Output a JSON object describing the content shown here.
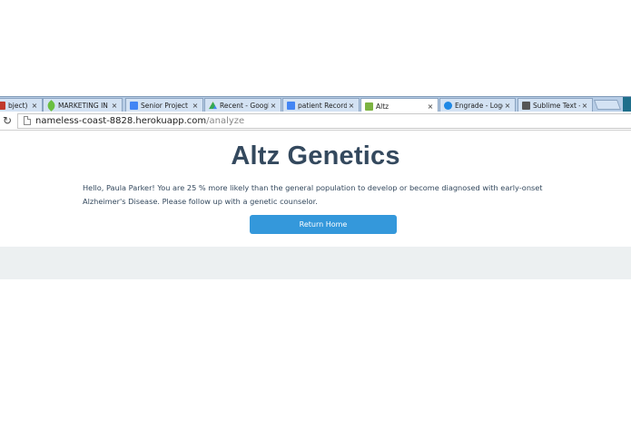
{
  "browser": {
    "tabs": [
      {
        "title": "bject) - n",
        "favicon": "gmail-icon",
        "color": "#c0392b"
      },
      {
        "title": "MARKETING IN",
        "favicon": "leaf-icon",
        "color": "#6abf40"
      },
      {
        "title": "Senior Project [",
        "favicon": "docs-icon",
        "color": "#4285f4"
      },
      {
        "title": "Recent - Google",
        "favicon": "drive-icon",
        "color": "#34a853"
      },
      {
        "title": "patient Records",
        "favicon": "docs-icon",
        "color": "#4285f4"
      },
      {
        "title": "Altz",
        "favicon": "app-icon",
        "color": "#7cb342",
        "active": true
      },
      {
        "title": "Engrade - Logo",
        "favicon": "engrade-icon",
        "color": "#1e88e5"
      },
      {
        "title": "Sublime Text - ",
        "favicon": "sublime-icon",
        "color": "#555555"
      }
    ],
    "close_glyph": "×",
    "url": {
      "host": "nameless-coast-8828.herokuapp.com",
      "path": "/analyze"
    }
  },
  "page": {
    "title": "Altz Genetics",
    "result_message": "Hello, Paula Parker! You are 25 % more likely than the general population to develop or become diagnosed with early-onset Alzheimer's Disease. Please follow up with a genetic counselor.",
    "return_button_label": "Return Home"
  },
  "colors": {
    "accent": "#3498db",
    "text": "#34495e",
    "footer": "#ecf0f1"
  }
}
